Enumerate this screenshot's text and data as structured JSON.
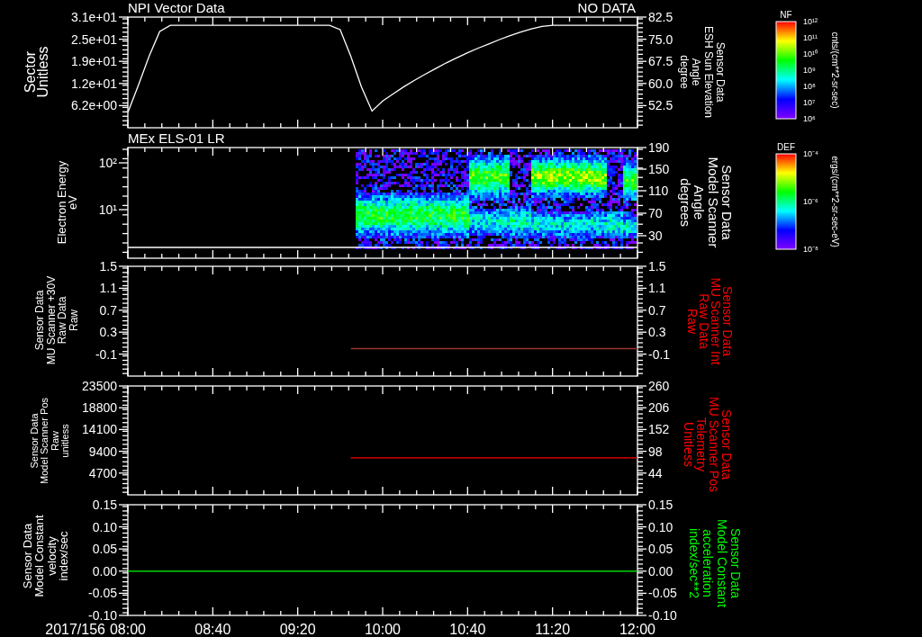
{
  "panels": [
    {
      "kind": "line",
      "title": "NPI Vector Data",
      "status": "NO DATA",
      "left_axis": {
        "label": [
          "Sector",
          "Unitless"
        ],
        "color": "#ffffff"
      },
      "right_axis": {
        "label": [
          "Sensor Data",
          "ESH Sun Elevation",
          "Angle",
          "degree"
        ],
        "color": "#ffffff",
        "ticks": [
          "82.5",
          "75.0",
          "67.5",
          "60.0",
          "52.5"
        ]
      },
      "chart_data": {
        "type": "line",
        "ylim": [
          0,
          31
        ],
        "yticks": [
          {
            "value": 31,
            "label": "3.1e+01"
          },
          {
            "value": 24.8,
            "label": "2.5e+01"
          },
          {
            "value": 18.6,
            "label": "1.9e+01"
          },
          {
            "value": 12.4,
            "label": "1.2e+01"
          },
          {
            "value": 6.2,
            "label": "6.2e+00"
          }
        ],
        "categories": [
          null,
          null,
          null,
          null,
          null,
          null,
          null,
          null,
          null,
          null,
          null,
          null,
          null,
          null,
          null,
          null,
          null,
          null,
          null,
          null,
          null,
          null,
          null,
          null,
          null,
          null,
          null,
          null,
          null,
          null,
          null,
          null,
          null,
          null,
          null,
          null,
          null,
          null,
          null,
          null,
          null,
          null,
          null,
          null,
          null,
          null,
          null,
          null,
          null
        ],
        "series": [
          {
            "color": "#ffffff",
            "values": [
              4.3,
              12,
              20,
              27,
              28.7,
              28.7,
              28.7,
              28.7,
              28.7,
              28.7,
              28.7,
              28.7,
              28.7,
              28.7,
              28.7,
              28.7,
              28.7,
              28.7,
              28.7,
              28.7,
              27.5,
              20,
              11.5,
              4.7,
              7.5,
              9.5,
              11.5,
              13.3,
              15,
              16.6,
              18.2,
              19.6,
              21,
              22.3,
              23.5,
              24.7,
              25.8,
              26.8,
              27.7,
              28.4,
              28.7,
              28.7,
              28.7,
              28.7,
              28.7,
              28.7,
              28.7,
              28.7,
              28.7
            ]
          }
        ]
      }
    },
    {
      "kind": "spectrogram",
      "title": "MEx ELS-01 LR",
      "left_axis": {
        "label": [
          "Electron Energy",
          "eV"
        ],
        "color": "#ffffff",
        "ticks": [
          "10²",
          "10¹"
        ]
      },
      "right_axis": {
        "label": [
          "Sensor Data",
          "Model Scanner",
          "Angle",
          "degrees"
        ],
        "color": "#ffffff",
        "ticks": [
          "190",
          "150",
          "110",
          "70",
          "30"
        ]
      }
    },
    {
      "kind": "line",
      "left_axis": {
        "label": [
          "Sensor Data",
          "MU Scanner +30V",
          "Raw Data",
          "Raw"
        ],
        "color": "#ffffff",
        "ticks": [
          "1.5",
          "1.1",
          "0.7",
          "0.3",
          "-0.1"
        ]
      },
      "right_axis": {
        "label": [
          "Sensor Data",
          "MU Scanner Int",
          "Raw Data",
          "Raw"
        ],
        "color": "#ff0000"
      },
      "chart_data": {
        "type": "line",
        "ylim": [
          -0.5,
          1.5
        ],
        "yticks": [
          {
            "value": 1.5,
            "label": "1.5"
          },
          {
            "value": 1.1,
            "label": "1.1"
          },
          {
            "value": 0.7,
            "label": "0.7"
          },
          {
            "value": 0.3,
            "label": "0.3"
          },
          {
            "value": -0.1,
            "label": "-0.1"
          }
        ],
        "categories": [
          null,
          null,
          null,
          null,
          null,
          null,
          null,
          null,
          null,
          null,
          null,
          null,
          null,
          null,
          null,
          null,
          null,
          null,
          null,
          null,
          null,
          null,
          null,
          null,
          null,
          null,
          null,
          null,
          null,
          null,
          null,
          null,
          null,
          null,
          null,
          null,
          null,
          null,
          null,
          null,
          null,
          null,
          null,
          null,
          null,
          null,
          null,
          null,
          null
        ],
        "series": [
          {
            "color": "#993333",
            "values": [
              null,
              null,
              null,
              null,
              null,
              null,
              null,
              null,
              null,
              null,
              null,
              null,
              null,
              null,
              null,
              null,
              null,
              null,
              null,
              null,
              null,
              0,
              0,
              0,
              0,
              0,
              0,
              0,
              0,
              0,
              0,
              0,
              0,
              0,
              0,
              0,
              0,
              0,
              0,
              0,
              0,
              0,
              0,
              0,
              0,
              0,
              0,
              0,
              0
            ]
          }
        ]
      }
    },
    {
      "kind": "line",
      "left_axis": {
        "label": [
          "Sensor Data",
          "Model Scanner Pos",
          "Raw",
          "unitless"
        ],
        "color": "#ffffff",
        "ticks": [
          "23500",
          "18800",
          "14100",
          "9400",
          "4700"
        ]
      },
      "right_axis": {
        "label": [
          "Sensor Data",
          "MU Scanner Pos",
          "Telemetry",
          "Unitless"
        ],
        "color": "#ff0000"
      },
      "chart_data": {
        "type": "line",
        "ylim": [
          -10,
          260
        ],
        "yticks": [
          {
            "value": 260,
            "label": "260"
          },
          {
            "value": 206,
            "label": "206"
          },
          {
            "value": 152,
            "label": "152"
          },
          {
            "value": 98,
            "label": "98"
          },
          {
            "value": 44,
            "label": "44"
          }
        ],
        "categories": [
          null,
          null,
          null,
          null,
          null,
          null,
          null,
          null,
          null,
          null,
          null,
          null,
          null,
          null,
          null,
          null,
          null,
          null,
          null,
          null,
          null,
          null,
          null,
          null,
          null,
          null,
          null,
          null,
          null,
          null,
          null,
          null,
          null,
          null,
          null,
          null,
          null,
          null,
          null,
          null,
          null,
          null,
          null,
          null,
          null,
          null,
          null,
          null,
          null
        ],
        "series": [
          {
            "color": "#ff0000",
            "values": [
              null,
              null,
              null,
              null,
              null,
              null,
              null,
              null,
              null,
              null,
              null,
              null,
              null,
              null,
              null,
              null,
              null,
              null,
              null,
              null,
              null,
              82,
              82,
              82,
              82,
              82,
              82,
              82,
              82,
              82,
              82,
              82,
              82,
              82,
              82,
              82,
              82,
              82,
              82,
              82,
              82,
              82,
              82,
              82,
              82,
              82,
              82,
              82,
              82
            ]
          }
        ]
      }
    },
    {
      "kind": "line",
      "date_label": "2017/156",
      "left_axis": {
        "label": [
          "Sensor Data",
          "Model Constant",
          "velocity",
          "index/sec"
        ],
        "color": "#ffffff",
        "ticks": [
          "0.15",
          "0.10",
          "0.05",
          "0.00",
          "-0.05",
          "-0.10"
        ]
      },
      "right_axis": {
        "label": [
          "Sensor Data",
          "Model Constant",
          "acceleration",
          "index/sec**2"
        ],
        "color": "#00ff00"
      },
      "chart_data": {
        "type": "line",
        "xlim": [
          8,
          12
        ],
        "ylim": [
          -0.1,
          0.15
        ],
        "yticks": [
          {
            "value": 0.15,
            "label": "0.15"
          },
          {
            "value": 0.1,
            "label": "0.10"
          },
          {
            "value": 0.05,
            "label": "0.05"
          },
          {
            "value": 0,
            "label": "0.00"
          },
          {
            "value": -0.05,
            "label": "-0.05"
          },
          {
            "value": -0.1,
            "label": "-0.10"
          }
        ],
        "xticks": [
          {
            "value": 8,
            "label": "08:00"
          },
          {
            "value": 8.6667,
            "label": "08:40"
          },
          {
            "value": 9.3333,
            "label": "09:20"
          },
          {
            "value": 10,
            "label": "10:00"
          },
          {
            "value": 10.6667,
            "label": "10:40"
          },
          {
            "value": 11.3333,
            "label": "11:20"
          },
          {
            "value": 12,
            "label": "12:00"
          }
        ],
        "x": [
          8,
          12
        ],
        "series": [
          {
            "color": "#00ff00",
            "values": [
              0,
              0
            ]
          }
        ]
      }
    }
  ],
  "colorbars": [
    {
      "title": "NF",
      "ticks": [
        "10¹²",
        "10¹¹",
        "10¹⁰",
        "10⁹",
        "10⁸",
        "10⁷",
        "10⁶"
      ],
      "unit": "cnts/(cm**2-sr-sec)"
    },
    {
      "title": "DEF",
      "ticks": [
        "10⁻⁴",
        "10⁻⁶",
        "10⁻⁸"
      ],
      "unit": "ergs/(cm**2-sr-sec-eV)"
    }
  ]
}
